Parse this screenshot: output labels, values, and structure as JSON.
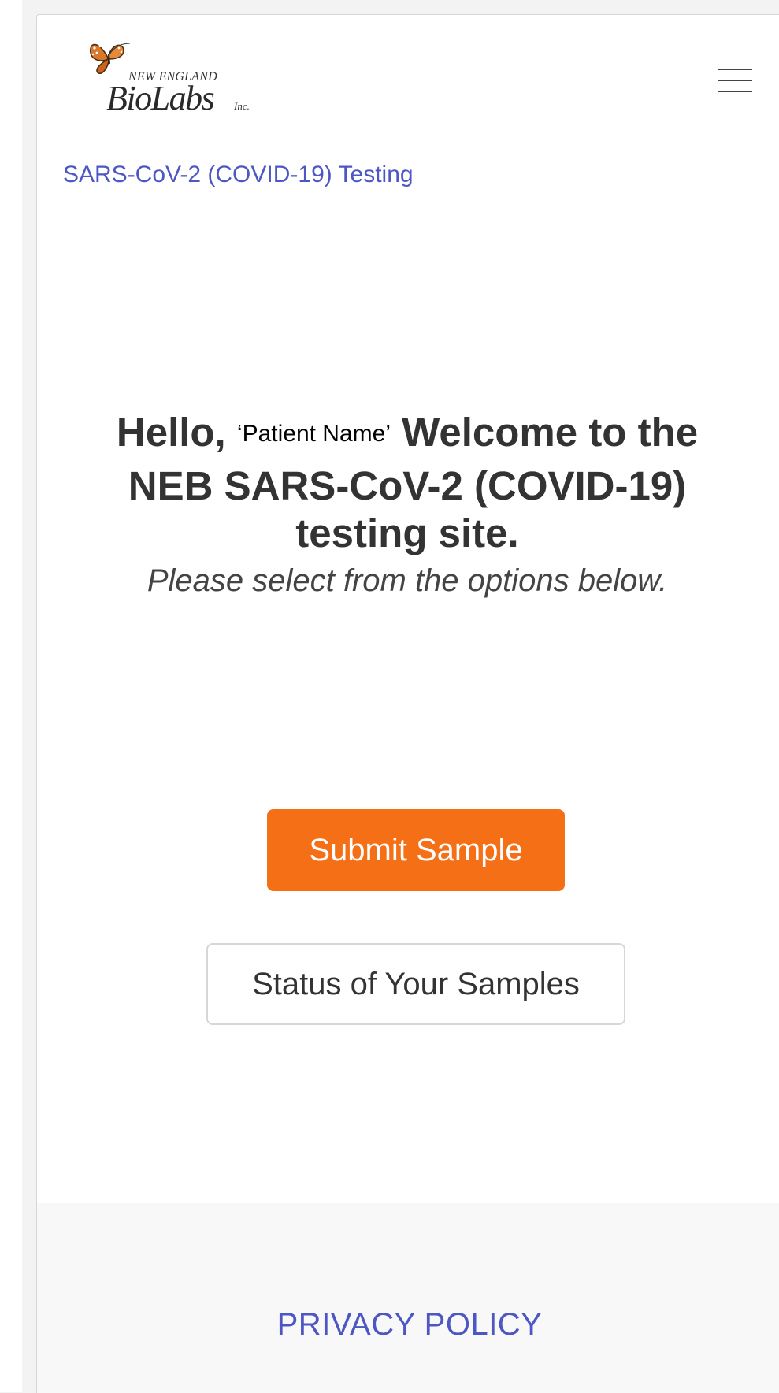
{
  "header": {
    "logo": {
      "line1": "NEW ENGLAND",
      "line2": "BioLabs",
      "suffix": "Inc."
    },
    "menu_icon": "hamburger-menu-icon"
  },
  "breadcrumb": "SARS-CoV-2 (COVID-19) Testing",
  "hero": {
    "greeting": "Hello,",
    "patient_name": "‘Patient Name’",
    "welcome": "Welcome to the NEB SARS-CoV-2 (COVID-19) testing site.",
    "subtitle": "Please select from the options below."
  },
  "actions": {
    "submit_label": "Submit Sample",
    "status_label": "Status of Your Samples"
  },
  "footer": {
    "privacy_label": "PRIVACY POLICY"
  },
  "colors": {
    "accent": "#f56f17",
    "link": "#4c57c4",
    "text": "#333333",
    "footer_bg": "#f8f8f8"
  }
}
